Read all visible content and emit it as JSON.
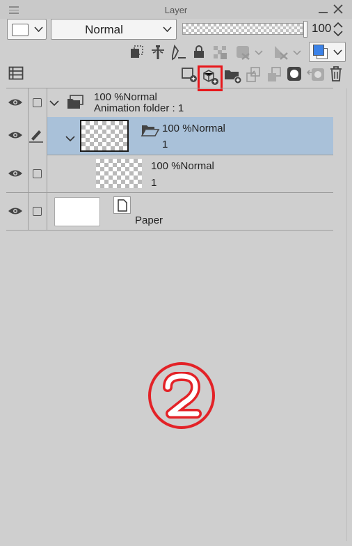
{
  "window": {
    "title": "Layer"
  },
  "toolbar": {
    "blend_mode": "Normal",
    "opacity_value": "100",
    "opacity_fraction": 1.0,
    "color_main": "#3b82e8",
    "highlight_color": "#e8171b"
  },
  "layers": [
    {
      "percent": "100 %Normal",
      "name": "Animation folder : 1",
      "type": "animation-folder",
      "expanded": true
    },
    {
      "percent": "100 %Normal",
      "name": "1",
      "type": "folder",
      "expanded": true,
      "selected": true
    },
    {
      "percent": "100 %Normal",
      "name": "1",
      "type": "raster"
    },
    {
      "name": "Paper",
      "type": "paper"
    }
  ],
  "annotation": {
    "number": "②"
  }
}
